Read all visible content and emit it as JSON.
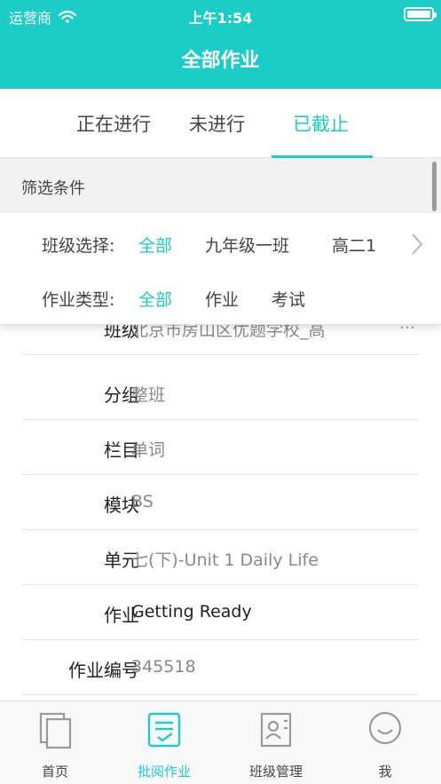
{
  "status_bar": {
    "carrier": "运营商",
    "time": "上午1:54"
  },
  "nav": {
    "title": "全部作业"
  },
  "tabs": [
    {
      "label": "正在进行",
      "active": false
    },
    {
      "label": "未进行",
      "active": false
    },
    {
      "label": "已截止",
      "active": true
    }
  ],
  "filter": {
    "header": "筛选条件",
    "class_row": {
      "label": "班级选择:",
      "options": [
        "全部",
        "九年级一班",
        "高二1"
      ],
      "selected": "全部"
    },
    "type_row": {
      "label": "作业类型:",
      "options": [
        "全部",
        "作业",
        "考试"
      ],
      "selected": "全部"
    }
  },
  "details": {
    "partial_row": {
      "label": "班级",
      "value": "北京市房山区优题学校_高",
      "more": "…"
    },
    "rows": [
      {
        "label": "分组",
        "value": "整班"
      },
      {
        "label": "栏目",
        "value": "单词"
      },
      {
        "label": "模块",
        "value": "BS"
      },
      {
        "label": "单元",
        "value": "七(下)-Unit 1 Daily Life"
      },
      {
        "label": "作业",
        "value": "Getting Ready"
      },
      {
        "label": "作业编号",
        "value": "345518"
      }
    ]
  },
  "tabbar": [
    {
      "label": "首页",
      "icon": "home-icon",
      "active": false
    },
    {
      "label": "批阅作业",
      "icon": "grade-homework-icon",
      "active": true
    },
    {
      "label": "班级管理",
      "icon": "class-management-icon",
      "active": false
    },
    {
      "label": "我",
      "icon": "profile-smile-icon",
      "active": false
    }
  ],
  "colors": {
    "accent": "#1ccdc7",
    "text": "#333333",
    "muted": "#888888"
  }
}
